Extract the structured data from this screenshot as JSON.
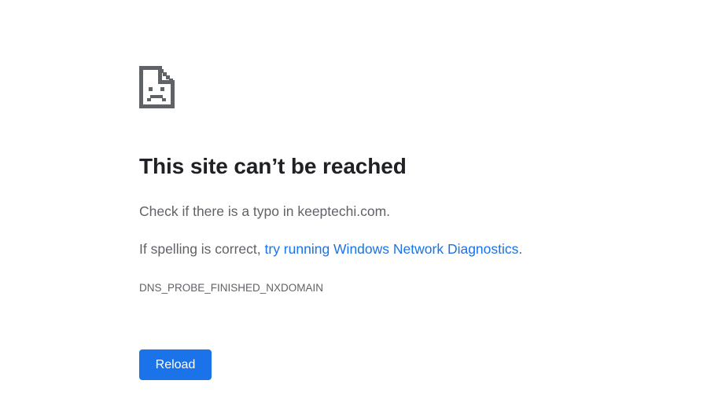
{
  "error": {
    "icon": "sad-document-icon",
    "title": "This site can’t be reached",
    "check_text": "Check if there is a typo in keeptechi.com.",
    "spelling_prefix": "If spelling is correct, ",
    "diagnostics_link": "try running Windows Network Diagnostics",
    "spelling_suffix": ".",
    "error_code": "DNS_PROBE_FINISHED_NXDOMAIN"
  },
  "actions": {
    "reload_label": "Reload"
  },
  "colors": {
    "accent": "#1a73e8",
    "title": "#202124",
    "body_text": "#5f6368",
    "icon": "#5f6368"
  }
}
